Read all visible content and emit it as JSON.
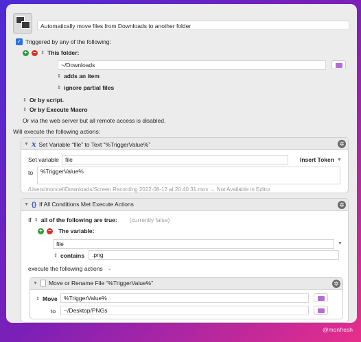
{
  "macro": {
    "title": "Automatically move files from Downloads to another folder"
  },
  "trigger": {
    "header": "Triggered by any of the following:",
    "folder_label": "This folder:",
    "folder_path": "~/Downloads",
    "adds_item": "adds an item",
    "ignore_partial": "ignore partial files",
    "or_script": "Or by script.",
    "or_execute_macro": "Or by Execute Macro",
    "web_server_note": "Or via the web server but all remote access is disabled."
  },
  "actions_header": "Will execute the following actions:",
  "action1": {
    "title": "Set Variable “file” to Text “%TriggerValue%”",
    "set_label": "Set variable",
    "variable": "file",
    "insert_token": "Insert Token",
    "to_label": "to",
    "value": "%TriggerValue%",
    "preview": "/Users/moncef/Downloads/Screen Recording 2022-08-12 at 20.40.31.mov → Not Available in Editor"
  },
  "action2": {
    "title": "If All Conditions Met Execute Actions",
    "if_label": "If",
    "conditions_mode": "all of the following are true:",
    "status": "(currently false)",
    "the_variable": "The variable:",
    "var_name": "file",
    "op": "contains",
    "op_value": ".png",
    "execute_label": "execute the following actions"
  },
  "action3": {
    "title": "Move or Rename File “%TriggerValue%”",
    "mode": "Move",
    "source": "%TriggerValue%",
    "to_label": "to",
    "dest": "~/Desktop/PNGs"
  },
  "credit": "@monfresh"
}
